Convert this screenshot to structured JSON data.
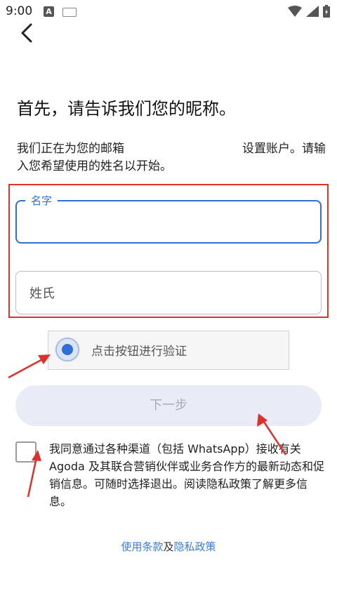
{
  "status_bar": {
    "time": "9:00",
    "notification_badge": "A",
    "icons": [
      "wifi-icon",
      "signal-icon",
      "battery-icon"
    ]
  },
  "nav": {
    "back_icon": "chevron-left-icon"
  },
  "title": "首先，请告诉我们您的昵称。",
  "description": {
    "before_email": "我们正在为您的邮箱",
    "after_email": "设置账户。请输入您希望使用的姓名以开始。"
  },
  "form": {
    "first_name": {
      "label": "名字",
      "value": ""
    },
    "last_name": {
      "placeholder": "姓氏",
      "value": ""
    }
  },
  "captcha": {
    "label": "点击按钮进行验证"
  },
  "next_button": {
    "label": "下一步"
  },
  "consent": {
    "checked": false,
    "text": "我同意通过各种渠道（包括 WhatsApp）接收有关 Agoda 及其联合营销伙伴或业务合作方的最新动态和促销信息。可随时选择退出。阅读隐私政策了解更多信息。"
  },
  "footer": {
    "terms_label": "使用条款",
    "separator": "及",
    "privacy_label": "隐私政策"
  },
  "colors": {
    "accent": "#2f6fd6",
    "annotation_red": "#e0302c",
    "button_disabled_bg": "#e9ecf6"
  }
}
